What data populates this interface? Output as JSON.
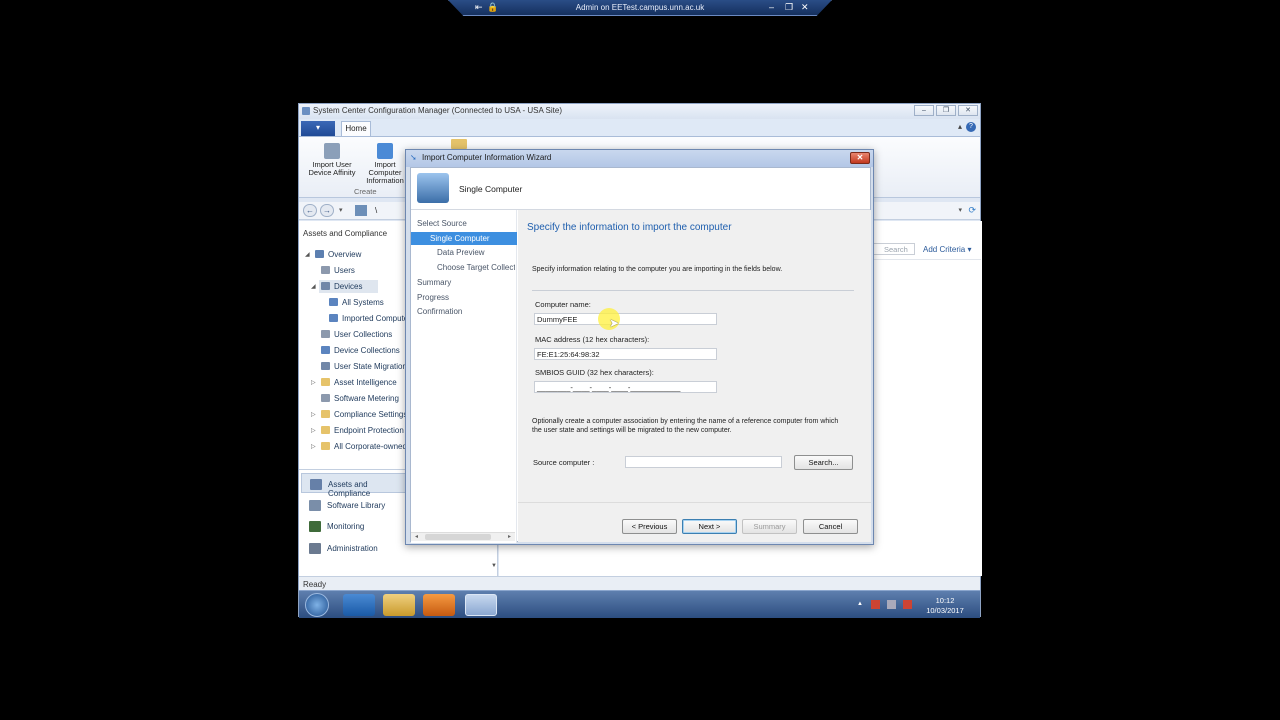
{
  "remote_bar": {
    "title": "Admin on EETest.campus.unn.ac.uk"
  },
  "app": {
    "title": "System Center Configuration Manager (Connected to USA - USA Site)",
    "file_tab": "▾",
    "home_tab": "Home",
    "ribbon": {
      "buttons": [
        {
          "label": "Import User Device Affinity"
        },
        {
          "label": "Import Computer Information"
        }
      ],
      "group_label": "Create"
    },
    "nav": {
      "path": "\\"
    },
    "workspace_title": "Assets and Compliance",
    "tree": [
      {
        "label": "Overview"
      },
      {
        "label": "Users"
      },
      {
        "label": "Devices"
      },
      {
        "label": "All Systems"
      },
      {
        "label": "Imported Computers"
      },
      {
        "label": "User Collections"
      },
      {
        "label": "Device Collections"
      },
      {
        "label": "User State Migration"
      },
      {
        "label": "Asset Intelligence"
      },
      {
        "label": "Software Metering"
      },
      {
        "label": "Compliance Settings"
      },
      {
        "label": "Endpoint Protection"
      },
      {
        "label": "All Corporate-owned Devices"
      }
    ],
    "workspaces": [
      {
        "label": "Assets and Compliance"
      },
      {
        "label": "Software Library"
      },
      {
        "label": "Monitoring"
      },
      {
        "label": "Administration"
      }
    ],
    "right": {
      "search_label": "Search",
      "add_criteria": "Add Criteria ▾"
    },
    "status": "Ready",
    "clock": {
      "time": "10:12",
      "date": "10/03/2017"
    }
  },
  "dialog": {
    "title": "Import Computer Information Wizard",
    "header": "Single Computer",
    "steps": [
      {
        "label": "Select Source"
      },
      {
        "label": "Single Computer"
      },
      {
        "label": "Data Preview"
      },
      {
        "label": "Choose Target Collection"
      },
      {
        "label": "Summary"
      },
      {
        "label": "Progress"
      },
      {
        "label": "Confirmation"
      }
    ],
    "heading": "Specify the information to import the computer",
    "intro": "Specify information relating to the computer you are importing in the fields below.",
    "computer_name_label": "Computer name:",
    "computer_name_value": "DummyFEE",
    "mac_label": "MAC address (12 hex characters):",
    "mac_value": "FE:E1:25:64:98:32",
    "smbios_label": "SMBIOS GUID (32 hex characters):",
    "smbios_value": "________-____-____-____-____________",
    "assoc_text_1": "Optionally create a computer association by entering the name of a reference computer from which",
    "assoc_text_2": "the user state and settings will be migrated to the new computer.",
    "source_label": "Source computer :",
    "source_value": "",
    "search_button": "Search...",
    "buttons": {
      "previous": "< Previous",
      "next": "Next >",
      "summary": "Summary",
      "cancel": "Cancel"
    }
  }
}
